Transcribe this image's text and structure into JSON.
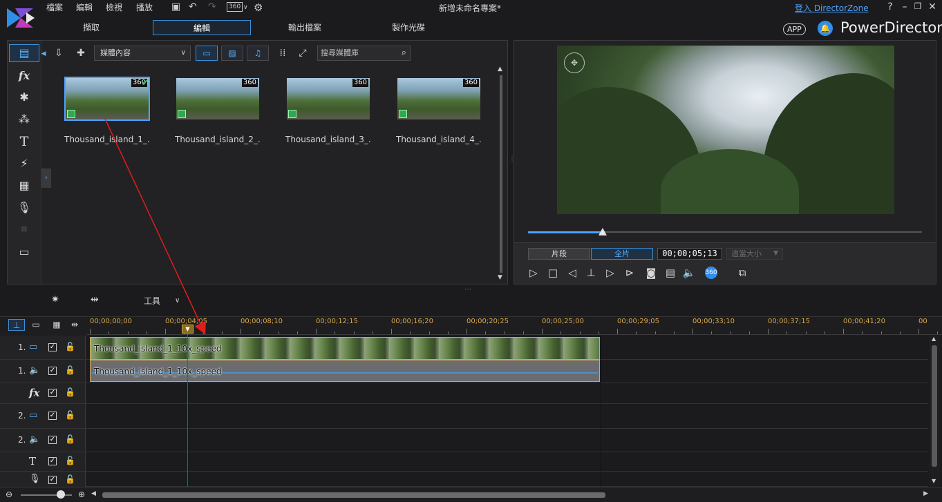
{
  "menu": [
    "檔案",
    "編輯",
    "檢視",
    "播放"
  ],
  "title": "新增未命名專案*",
  "login_link": "登入 DirectorZone",
  "mode_tabs": [
    "擷取",
    "編輯",
    "輸出檔案",
    "製作光碟"
  ],
  "app_badge": "APP",
  "brand": "PowerDirector",
  "library": {
    "media_select": "媒體內容",
    "search_placeholder": "搜尋媒體庫",
    "clips": [
      {
        "name": "Thousand_island_1_...",
        "badge": "360"
      },
      {
        "name": "Thousand_island_2_...",
        "badge": "360"
      },
      {
        "name": "Thousand_island_3_...",
        "badge": "360"
      },
      {
        "name": "Thousand_island_4_...",
        "badge": "360"
      }
    ]
  },
  "preview": {
    "seg_clip": "片段",
    "seg_movie": "全片",
    "timecode": "00;00;05;13",
    "size_select": "適當大小",
    "icon_360": "360",
    "seek_progress": 0.19
  },
  "timeline_toolbar": {
    "tools_label": "工具"
  },
  "ruler_ticks": [
    "00;00;00;00",
    "00;00;04;05",
    "00;00;08;10",
    "00;00;12;15",
    "00;00;16;20",
    "00;00;20;25",
    "00;00;25;00",
    "00;00;29;05",
    "00;00;33;10",
    "00;00;37;15",
    "00;00;41;20",
    "00"
  ],
  "tracks": [
    {
      "num": "1.",
      "type": "video"
    },
    {
      "num": "1.",
      "type": "audio"
    },
    {
      "num": "",
      "type": "fx"
    },
    {
      "num": "2.",
      "type": "video"
    },
    {
      "num": "2.",
      "type": "audio"
    },
    {
      "num": "",
      "type": "title"
    },
    {
      "num": "",
      "type": "voice"
    }
  ],
  "timeline_clips": {
    "video": "Thousand_island_1_10x_speed",
    "audio": "Thousand_island_1_10x_speed"
  },
  "colors": {
    "accent": "#4da3ff",
    "clip_border": "#d7a64a",
    "playhead": "#d32020"
  }
}
